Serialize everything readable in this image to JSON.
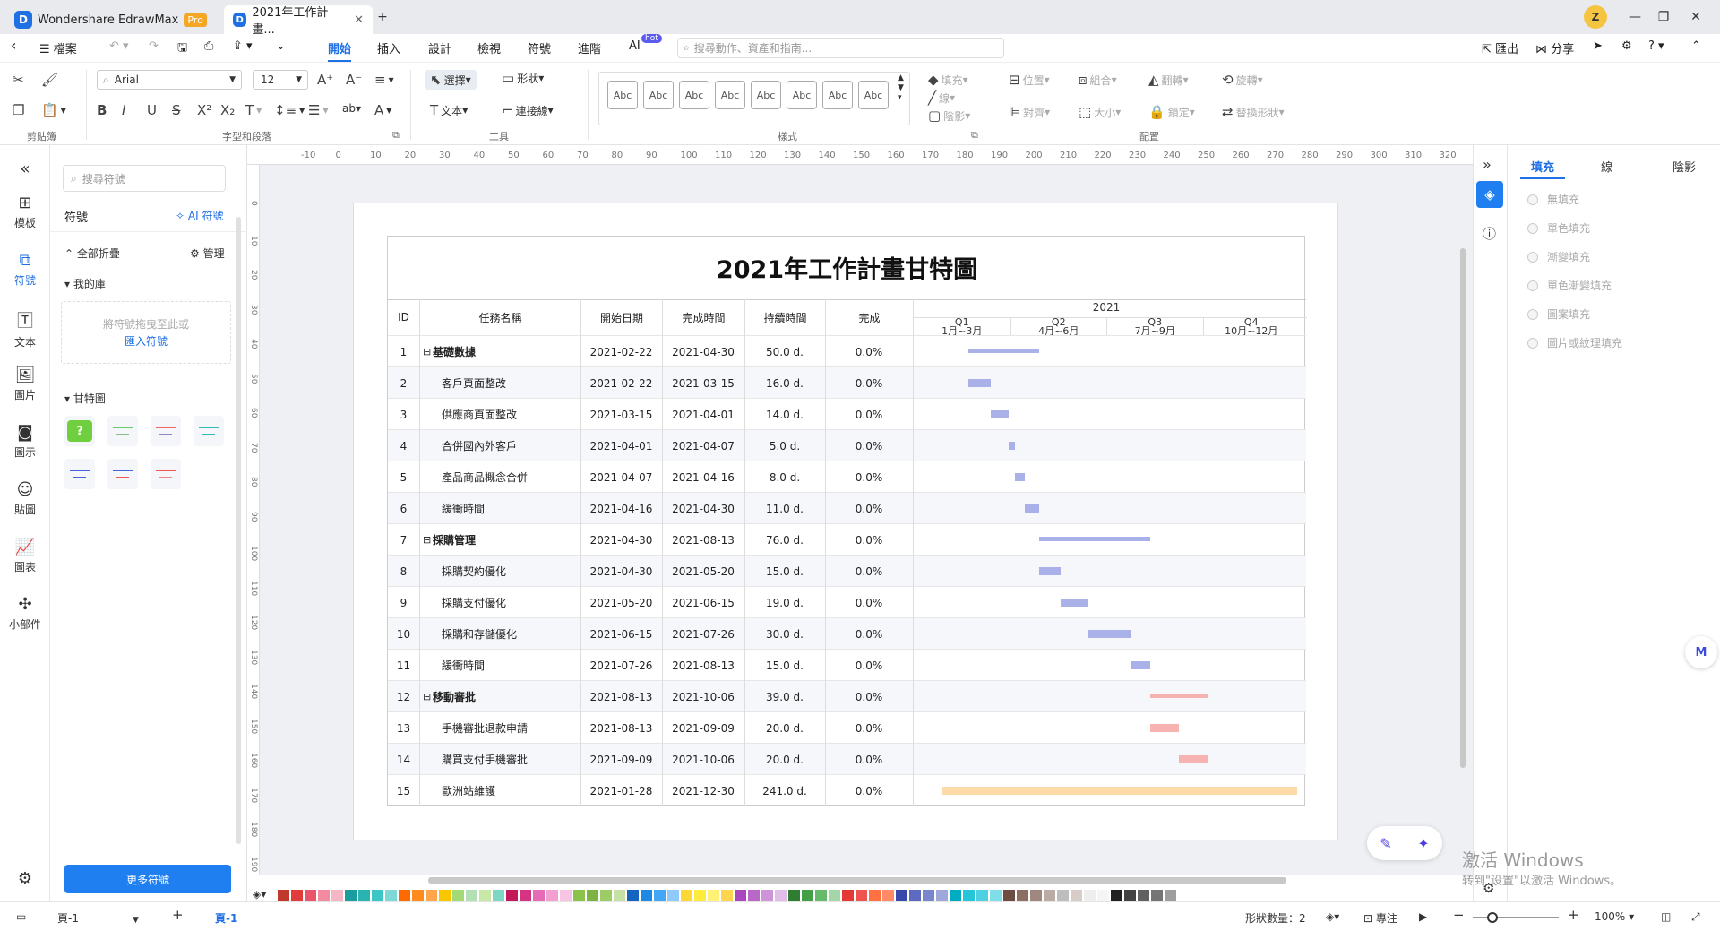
{
  "app": {
    "name": "Wondershare EdrawMax",
    "badge": "Pro",
    "doc_tab": "2021年工作計畫..."
  },
  "menu": {
    "file": "檔案",
    "items": [
      "開始",
      "插入",
      "設計",
      "檢視",
      "符號",
      "進階",
      "AI"
    ],
    "ai_badge": "hot",
    "search_placeholder": "搜尋動作、資產和指南...",
    "export": "匯出",
    "share": "分享"
  },
  "ribbon": {
    "font": "Arial",
    "font_size": "12",
    "select": "選擇",
    "shape": "形狀",
    "text": "文本",
    "connector": "連接線",
    "style_box": "Abc",
    "fill": "填充",
    "line": "線",
    "shadow": "陰影",
    "position": "位置",
    "align": "對齊",
    "group": "組合",
    "size": "大小",
    "flip": "翻轉",
    "lock": "鎖定",
    "rotate": "旋轉",
    "replace": "替換形狀",
    "ab": "ab",
    "groups": {
      "clipboard": "剪貼簿",
      "font": "字型和段落",
      "tools": "工具",
      "style": "樣式",
      "arrange": "配置"
    }
  },
  "leftnav": [
    {
      "label": "模板"
    },
    {
      "label": "符號"
    },
    {
      "label": "文本"
    },
    {
      "label": "圖片"
    },
    {
      "label": "圖示"
    },
    {
      "label": "貼圖"
    },
    {
      "label": "圖表"
    },
    {
      "label": "小部件"
    }
  ],
  "library": {
    "search_placeholder": "搜尋符號",
    "title": "符號",
    "ai": "AI 符號",
    "collapse": "全部折疊",
    "manage": "管理",
    "my_lib": "我的庫",
    "drop_hint": "將符號拖曳至此或",
    "import": "匯入符號",
    "gantt_section": "甘特圖",
    "more": "更多符號"
  },
  "gantt": {
    "title": "2021年工作計畫甘特圖",
    "headers": [
      "ID",
      "任務名稱",
      "開始日期",
      "完成時間",
      "持續時間",
      "完成"
    ],
    "year": "2021",
    "quarters": [
      {
        "q": "Q1",
        "range": "1月~3月"
      },
      {
        "q": "Q2",
        "range": "4月~6月"
      },
      {
        "q": "Q3",
        "range": "7月~9月"
      },
      {
        "q": "Q4",
        "range": "10月~12月"
      }
    ],
    "rows": [
      {
        "id": "1",
        "name": "基礎數據",
        "start": "2021-02-22",
        "end": "2021-04-30",
        "dur": "50.0 d.",
        "done": "0.0%",
        "bold": true,
        "color": "#a9b1e8",
        "s": 53,
        "e": 120
      },
      {
        "id": "2",
        "name": "客戶頁面整改",
        "start": "2021-02-22",
        "end": "2021-03-15",
        "dur": "16.0 d.",
        "done": "0.0%",
        "color": "#a9b1e8",
        "s": 53,
        "e": 74
      },
      {
        "id": "3",
        "name": "供應商頁面整改",
        "start": "2021-03-15",
        "end": "2021-04-01",
        "dur": "14.0 d.",
        "done": "0.0%",
        "color": "#a9b1e8",
        "s": 74,
        "e": 91
      },
      {
        "id": "4",
        "name": "合併國內外客戶",
        "start": "2021-04-01",
        "end": "2021-04-07",
        "dur": "5.0 d.",
        "done": "0.0%",
        "color": "#a9b1e8",
        "s": 91,
        "e": 97
      },
      {
        "id": "5",
        "name": "產品商品概念合併",
        "start": "2021-04-07",
        "end": "2021-04-16",
        "dur": "8.0 d.",
        "done": "0.0%",
        "color": "#a9b1e8",
        "s": 97,
        "e": 106
      },
      {
        "id": "6",
        "name": "緩衝時間",
        "start": "2021-04-16",
        "end": "2021-04-30",
        "dur": "11.0 d.",
        "done": "0.0%",
        "color": "#a9b1e8",
        "s": 106,
        "e": 120
      },
      {
        "id": "7",
        "name": "採購管理",
        "start": "2021-04-30",
        "end": "2021-08-13",
        "dur": "76.0 d.",
        "done": "0.0%",
        "bold": true,
        "color": "#a9b1e8",
        "s": 120,
        "e": 225
      },
      {
        "id": "8",
        "name": "採購契約優化",
        "start": "2021-04-30",
        "end": "2021-05-20",
        "dur": "15.0 d.",
        "done": "0.0%",
        "color": "#a9b1e8",
        "s": 120,
        "e": 140
      },
      {
        "id": "9",
        "name": "採購支付優化",
        "start": "2021-05-20",
        "end": "2021-06-15",
        "dur": "19.0 d.",
        "done": "0.0%",
        "color": "#a9b1e8",
        "s": 140,
        "e": 166
      },
      {
        "id": "10",
        "name": "採購和存儲優化",
        "start": "2021-06-15",
        "end": "2021-07-26",
        "dur": "30.0 d.",
        "done": "0.0%",
        "color": "#a9b1e8",
        "s": 166,
        "e": 207
      },
      {
        "id": "11",
        "name": "緩衝時間",
        "start": "2021-07-26",
        "end": "2021-08-13",
        "dur": "15.0 d.",
        "done": "0.0%",
        "color": "#a9b1e8",
        "s": 207,
        "e": 225
      },
      {
        "id": "12",
        "name": "移動審批",
        "start": "2021-08-13",
        "end": "2021-10-06",
        "dur": "39.0 d.",
        "done": "0.0%",
        "bold": true,
        "color": "#f7b2b2",
        "s": 225,
        "e": 279
      },
      {
        "id": "13",
        "name": "手機審批退款申請",
        "start": "2021-08-13",
        "end": "2021-09-09",
        "dur": "20.0 d.",
        "done": "0.0%",
        "color": "#f7b2b2",
        "s": 225,
        "e": 252
      },
      {
        "id": "14",
        "name": "購買支付手機審批",
        "start": "2021-09-09",
        "end": "2021-10-06",
        "dur": "20.0 d.",
        "done": "0.0%",
        "color": "#f7b2b2",
        "s": 252,
        "e": 279
      },
      {
        "id": "15",
        "name": "歐洲站維護",
        "start": "2021-01-28",
        "end": "2021-12-30",
        "dur": "241.0 d.",
        "done": "0.0%",
        "color": "#fddba8",
        "s": 28,
        "e": 364
      }
    ]
  },
  "rightpanel": {
    "tabs": [
      "填充",
      "線",
      "陰影"
    ],
    "options": [
      "無填充",
      "單色填充",
      "漸變填充",
      "單色漸變填充",
      "圖案填充",
      "圖片或紋理填充"
    ]
  },
  "status": {
    "page_sel": "頁-1",
    "page_tab": "頁-1",
    "shape_count": "形狀數量：2",
    "focus": "專注",
    "zoom": "100%"
  },
  "watermark": {
    "line1": "激活 Windows",
    "line2": "转到\"设置\"以激活 Windows。"
  },
  "palette": [
    "#c0392b",
    "#e03c3c",
    "#e9546b",
    "#f28aa0",
    "#f5b7c5",
    "#1a9d9d",
    "#2ab3b3",
    "#3cc6c6",
    "#7fd8d8",
    "#ff6a00",
    "#ff8c1a",
    "#ffa64d",
    "#f9c600",
    "#a3d977",
    "#b3e0b3",
    "#c9e8a8",
    "#7ed6c4",
    "#c2185b",
    "#d63384",
    "#e56cb4",
    "#f2a0d2",
    "#f7c5e3",
    "#8bc34a",
    "#7cb342",
    "#9ccc65",
    "#c5e1a5",
    "#1565c0",
    "#1e88e5",
    "#42a5f5",
    "#90caf9",
    "#fdd835",
    "#ffeb3b",
    "#fff176",
    "#ffd54f",
    "#ab47bc",
    "#ba68c8",
    "#ce93d8",
    "#e1bee7",
    "#2e7d32",
    "#43a047",
    "#66bb6a",
    "#a5d6a7",
    "#e53935",
    "#ef5350",
    "#ff7043",
    "#ff8a65",
    "#3949ab",
    "#5c6bc0",
    "#7986cb",
    "#9fa8da",
    "#00acc1",
    "#26c6da",
    "#4dd0e1",
    "#80deea",
    "#6d4c41",
    "#8d6e63",
    "#a1887f",
    "#bcaaa4",
    "#bdbdbd",
    "#d7ccc8",
    "#eeeeee",
    "#f5f5f5",
    "#212121",
    "#424242",
    "#616161",
    "#757575",
    "#9e9e9e"
  ]
}
